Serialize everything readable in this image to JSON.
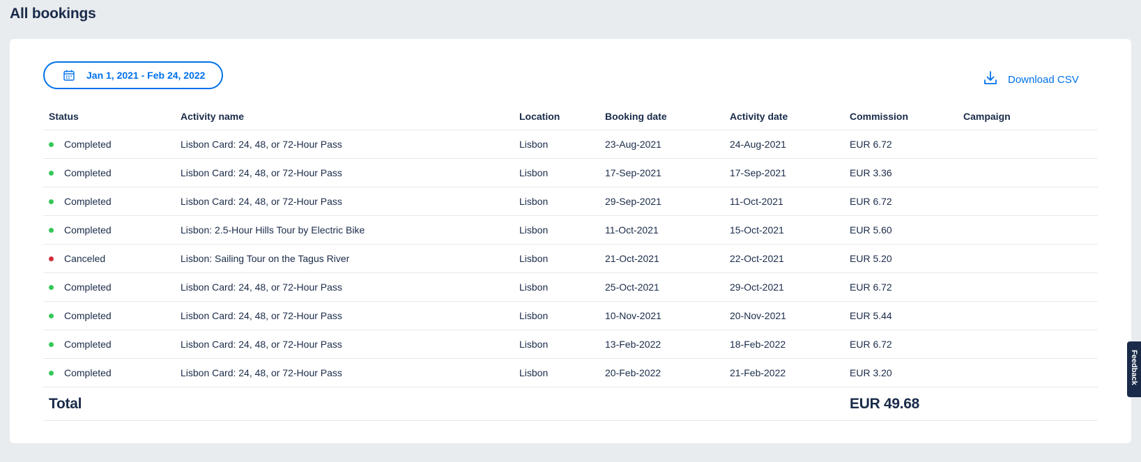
{
  "page_title": "All bookings",
  "filters": {
    "date_range_label": "Jan 1, 2021 - Feb 24, 2022",
    "date_icon": "calendar-icon"
  },
  "download": {
    "label": "Download CSV",
    "icon": "download-icon"
  },
  "table": {
    "headers": [
      "Status",
      "Activity name",
      "Location",
      "Booking date",
      "Activity date",
      "Commission",
      "Campaign"
    ],
    "rows": [
      {
        "status": "Completed",
        "status_color": "#34c759",
        "activity": "Lisbon Card: 24, 48, or 72-Hour Pass",
        "location": "Lisbon",
        "booking_date": "23-Aug-2021",
        "activity_date": "24-Aug-2021",
        "commission": "EUR 6.72",
        "campaign": ""
      },
      {
        "status": "Completed",
        "status_color": "#34c759",
        "activity": "Lisbon Card: 24, 48, or 72-Hour Pass",
        "location": "Lisbon",
        "booking_date": "17-Sep-2021",
        "activity_date": "17-Sep-2021",
        "commission": "EUR 3.36",
        "campaign": ""
      },
      {
        "status": "Completed",
        "status_color": "#34c759",
        "activity": "Lisbon Card: 24, 48, or 72-Hour Pass",
        "location": "Lisbon",
        "booking_date": "29-Sep-2021",
        "activity_date": "11-Oct-2021",
        "commission": "EUR 6.72",
        "campaign": ""
      },
      {
        "status": "Completed",
        "status_color": "#34c759",
        "activity": "Lisbon: 2.5-Hour Hills Tour by Electric Bike",
        "location": "Lisbon",
        "booking_date": "11-Oct-2021",
        "activity_date": "15-Oct-2021",
        "commission": "EUR 5.60",
        "campaign": ""
      },
      {
        "status": "Canceled",
        "status_color": "#d22d3c",
        "activity": "Lisbon: Sailing Tour on the Tagus River",
        "location": "Lisbon",
        "booking_date": "21-Oct-2021",
        "activity_date": "22-Oct-2021",
        "commission": "EUR 5.20",
        "campaign": ""
      },
      {
        "status": "Completed",
        "status_color": "#34c759",
        "activity": "Lisbon Card: 24, 48, or 72-Hour Pass",
        "location": "Lisbon",
        "booking_date": "25-Oct-2021",
        "activity_date": "29-Oct-2021",
        "commission": "EUR 6.72",
        "campaign": ""
      },
      {
        "status": "Completed",
        "status_color": "#34c759",
        "activity": "Lisbon Card: 24, 48, or 72-Hour Pass",
        "location": "Lisbon",
        "booking_date": "10-Nov-2021",
        "activity_date": "20-Nov-2021",
        "commission": "EUR 5.44",
        "campaign": ""
      },
      {
        "status": "Completed",
        "status_color": "#34c759",
        "activity": "Lisbon Card: 24, 48, or 72-Hour Pass",
        "location": "Lisbon",
        "booking_date": "13-Feb-2022",
        "activity_date": "18-Feb-2022",
        "commission": "EUR 6.72",
        "campaign": ""
      },
      {
        "status": "Completed",
        "status_color": "#34c759",
        "activity": "Lisbon Card: 24, 48, or 72-Hour Pass",
        "location": "Lisbon",
        "booking_date": "20-Feb-2022",
        "activity_date": "21-Feb-2022",
        "commission": "EUR 3.20",
        "campaign": ""
      }
    ],
    "total": {
      "label": "Total",
      "amount": "EUR 49.68"
    }
  },
  "feedback_tab": {
    "label": "Feedback"
  }
}
